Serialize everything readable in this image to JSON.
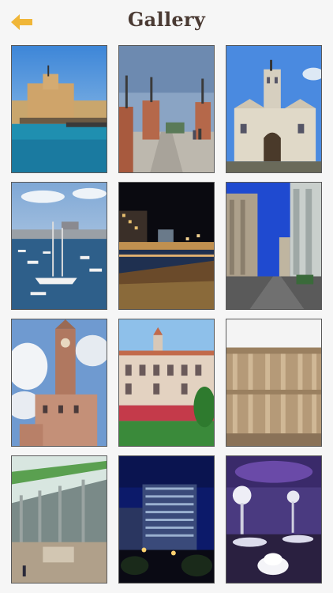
{
  "header": {
    "title": "Gallery",
    "back_icon": "arrow-left-icon",
    "accent": "#f0b638"
  },
  "gallery": {
    "items": [
      {
        "name": "citadel-qaitbay"
      },
      {
        "name": "stanley-bridge"
      },
      {
        "name": "castle-tower"
      },
      {
        "name": "eastern-harbor-boats"
      },
      {
        "name": "corniche-night"
      },
      {
        "name": "city-street-buildings"
      },
      {
        "name": "clock-tower"
      },
      {
        "name": "montaza-palace"
      },
      {
        "name": "library-of-celsus"
      },
      {
        "name": "bibliotheca-interior"
      },
      {
        "name": "hotel-night"
      },
      {
        "name": "banquet-hall"
      }
    ]
  }
}
